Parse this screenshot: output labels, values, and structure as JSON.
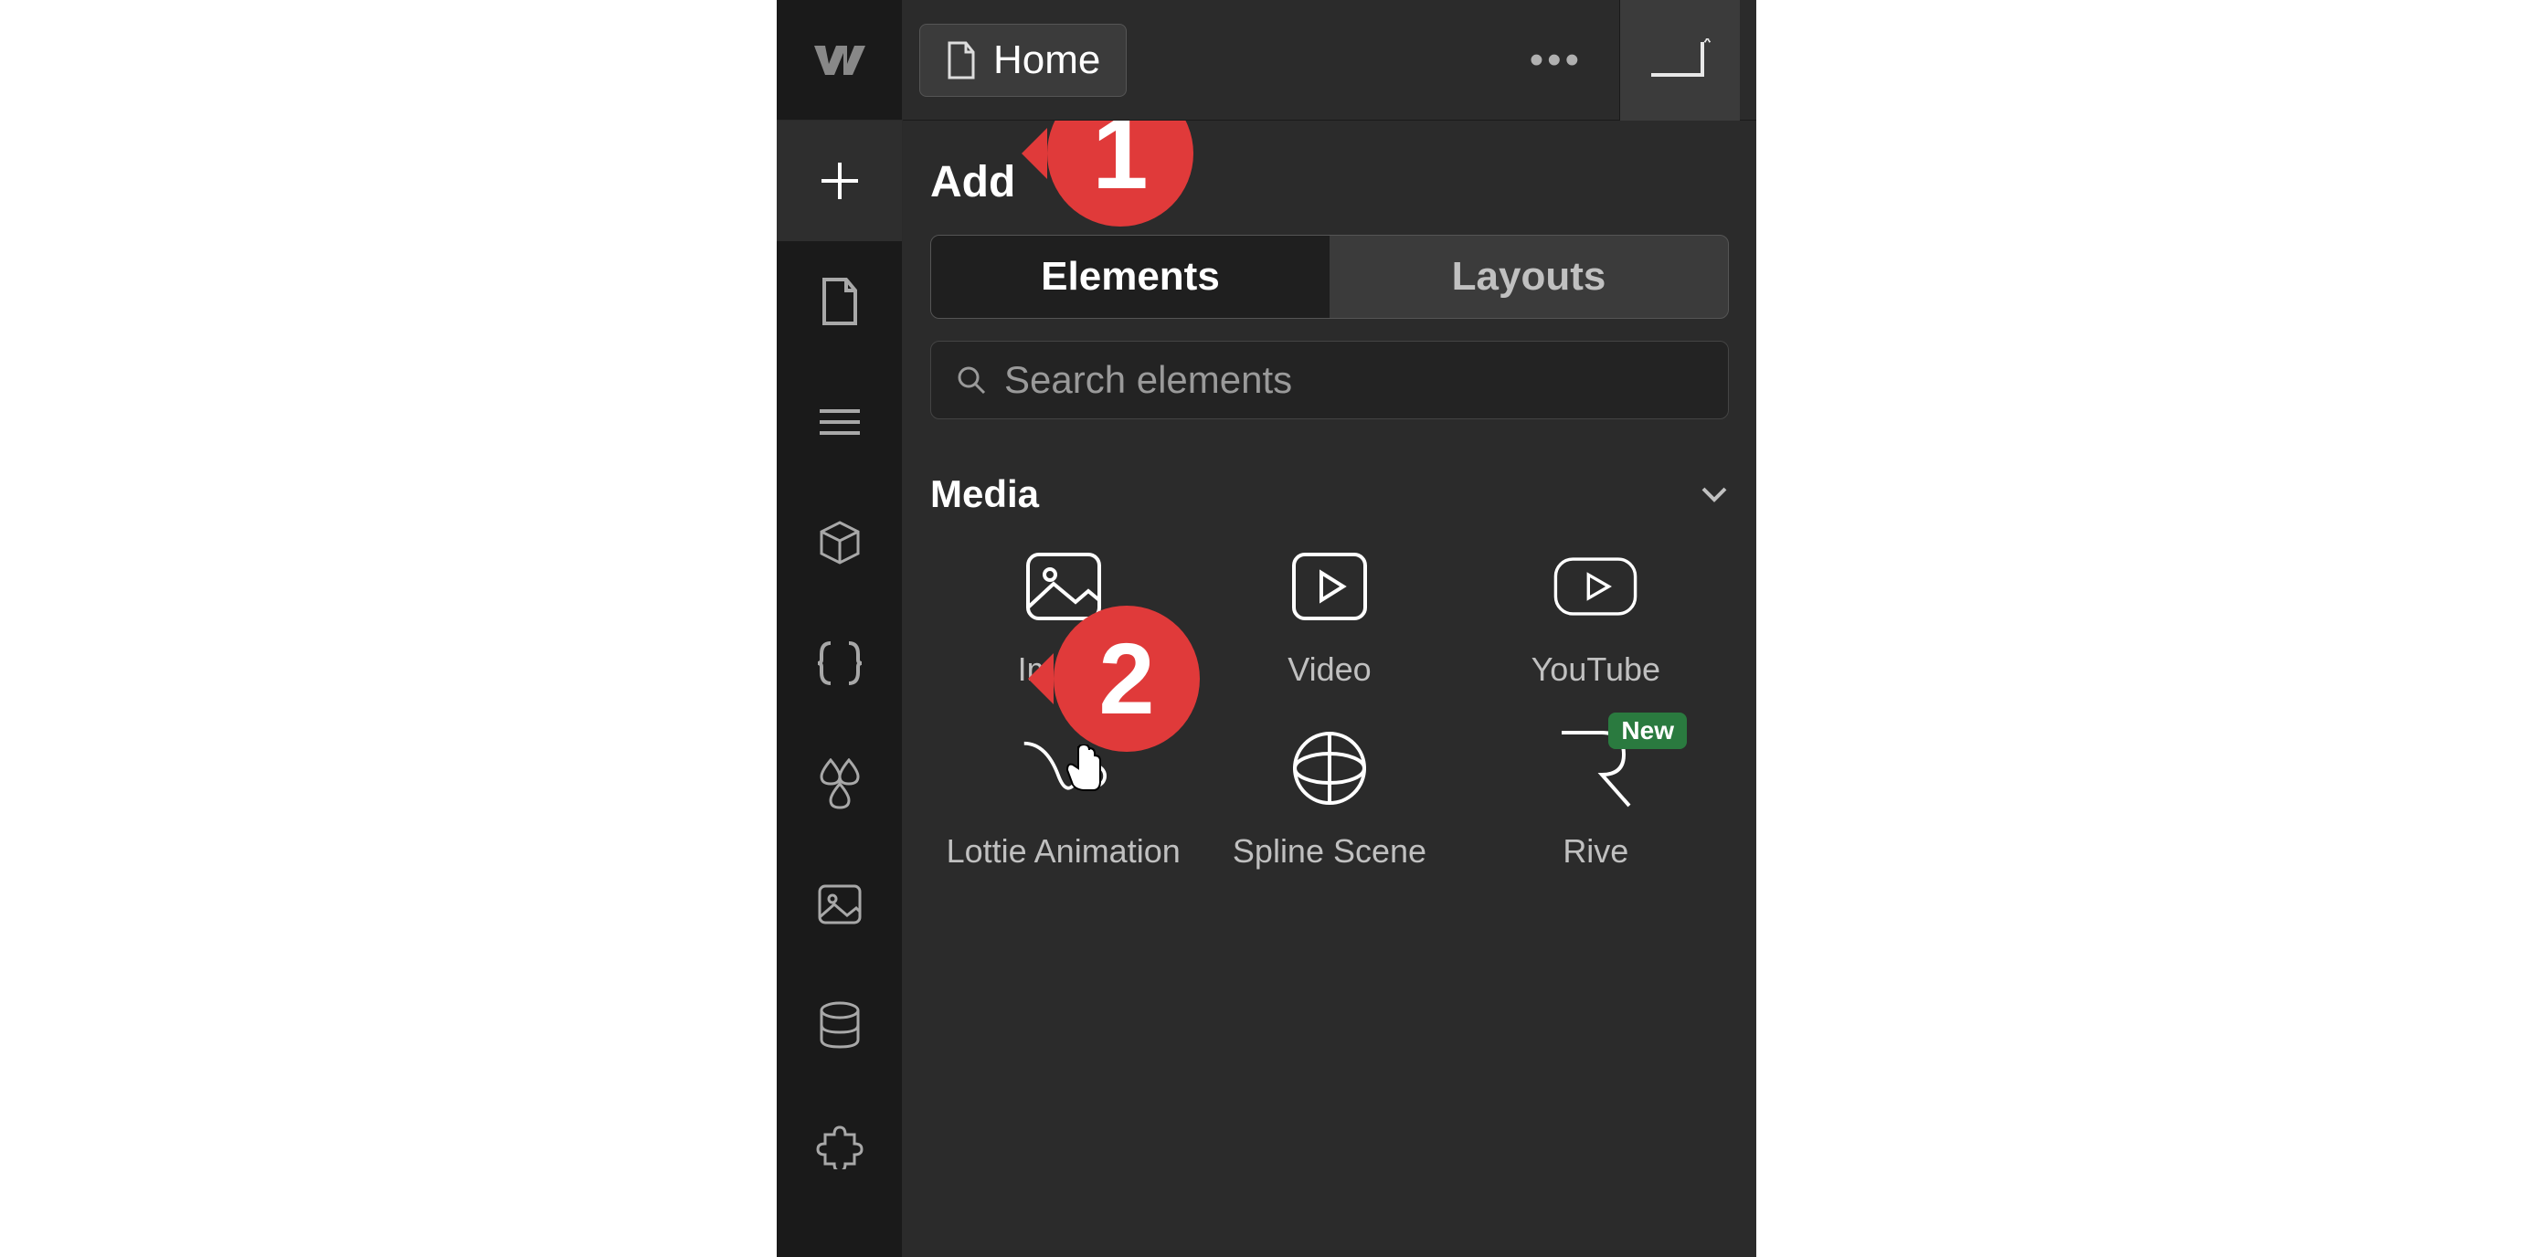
{
  "topbar": {
    "page_name": "Home"
  },
  "panel": {
    "title": "Add",
    "tabs": {
      "elements": "Elements",
      "layouts": "Layouts"
    },
    "search_placeholder": "Search elements"
  },
  "section": {
    "title": "Media",
    "items": {
      "image": "Image",
      "video": "Video",
      "youtube": "YouTube",
      "lottie": "Lottie Animation",
      "spline": "Spline Scene",
      "rive": "Rive"
    },
    "badge_new": "New"
  },
  "callouts": {
    "one": "1",
    "two": "2"
  }
}
